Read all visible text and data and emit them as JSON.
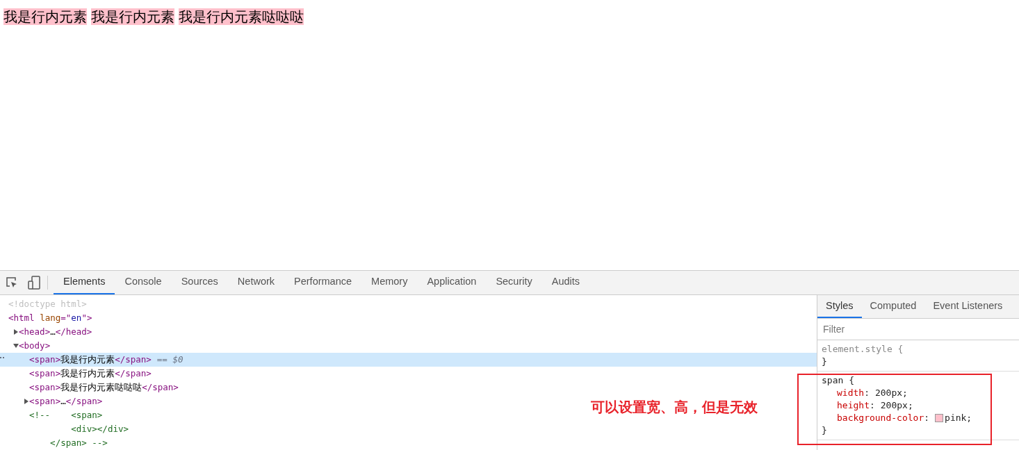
{
  "page": {
    "spans": [
      "我是行内元素",
      "我是行内元素",
      "我是行内元素哒哒哒"
    ]
  },
  "toolbar": {
    "tabs": [
      {
        "label": "Elements",
        "selected": true
      },
      {
        "label": "Console",
        "selected": false
      },
      {
        "label": "Sources",
        "selected": false
      },
      {
        "label": "Network",
        "selected": false
      },
      {
        "label": "Performance",
        "selected": false
      },
      {
        "label": "Memory",
        "selected": false
      },
      {
        "label": "Application",
        "selected": false
      },
      {
        "label": "Security",
        "selected": false
      },
      {
        "label": "Audits",
        "selected": false
      }
    ]
  },
  "dom_tree": [
    {
      "selected": false,
      "parts": [
        {
          "kind": "doctype",
          "text": "<!doctype html>"
        }
      ]
    },
    {
      "selected": false,
      "parts": [
        {
          "kind": "tag",
          "text": "<html"
        },
        {
          "kind": "attr",
          "text": " lang"
        },
        {
          "kind": "tag",
          "text": "=\""
        },
        {
          "kind": "value",
          "text": "en"
        },
        {
          "kind": "tag",
          "text": "\">"
        }
      ],
      "children": [
        {
          "selected": false,
          "expanded": false,
          "parts": [
            {
              "kind": "tag",
              "text": "<head>"
            },
            {
              "kind": "text",
              "text": "…"
            },
            {
              "kind": "tag",
              "text": "</head>"
            }
          ]
        },
        {
          "selected": false,
          "expanded": true,
          "parts": [
            {
              "kind": "tag",
              "text": "<body>"
            }
          ],
          "children": [
            {
              "selected": true,
              "parts": [
                {
                  "kind": "tag",
                  "text": "<span>"
                },
                {
                  "kind": "text",
                  "text": "我是行内元素"
                },
                {
                  "kind": "tag",
                  "text": "</span>"
                }
              ],
              "suffix": "== $0"
            },
            {
              "selected": false,
              "parts": [
                {
                  "kind": "tag",
                  "text": "<span>"
                },
                {
                  "kind": "text",
                  "text": "我是行内元素"
                },
                {
                  "kind": "tag",
                  "text": "</span>"
                }
              ]
            },
            {
              "selected": false,
              "parts": [
                {
                  "kind": "tag",
                  "text": "<span>"
                },
                {
                  "kind": "text",
                  "text": "我是行内元素哒哒哒"
                },
                {
                  "kind": "tag",
                  "text": "</span>"
                }
              ]
            },
            {
              "selected": false,
              "expanded": false,
              "parts": [
                {
                  "kind": "tag",
                  "text": "<span>"
                },
                {
                  "kind": "text",
                  "text": "…"
                },
                {
                  "kind": "tag",
                  "text": "</span>"
                }
              ]
            },
            {
              "selected": false,
              "parts": [
                {
                  "kind": "comment",
                  "text": "<!--    <span>\n        <div></div>\n    </span> -->"
                }
              ]
            }
          ]
        }
      ]
    }
  ],
  "styles_panel": {
    "tabs": [
      {
        "label": "Styles",
        "selected": true
      },
      {
        "label": "Computed",
        "selected": false
      },
      {
        "label": "Event Listeners",
        "selected": false
      }
    ],
    "filter": {
      "placeholder": "Filter"
    },
    "rules": [
      {
        "selector": "element.style {",
        "close": "}"
      },
      {
        "selector": "span {",
        "declarations": [
          {
            "property": "width",
            "separator": ":",
            "value": "200px;"
          },
          {
            "property": "height",
            "separator": ":",
            "value": "200px;"
          },
          {
            "property": "background-color",
            "separator": ":",
            "value": "pink;",
            "color": "#ffc0cb"
          }
        ],
        "close": "}"
      }
    ]
  },
  "annotation": {
    "text": "可以设置宽、高，但是无效"
  }
}
